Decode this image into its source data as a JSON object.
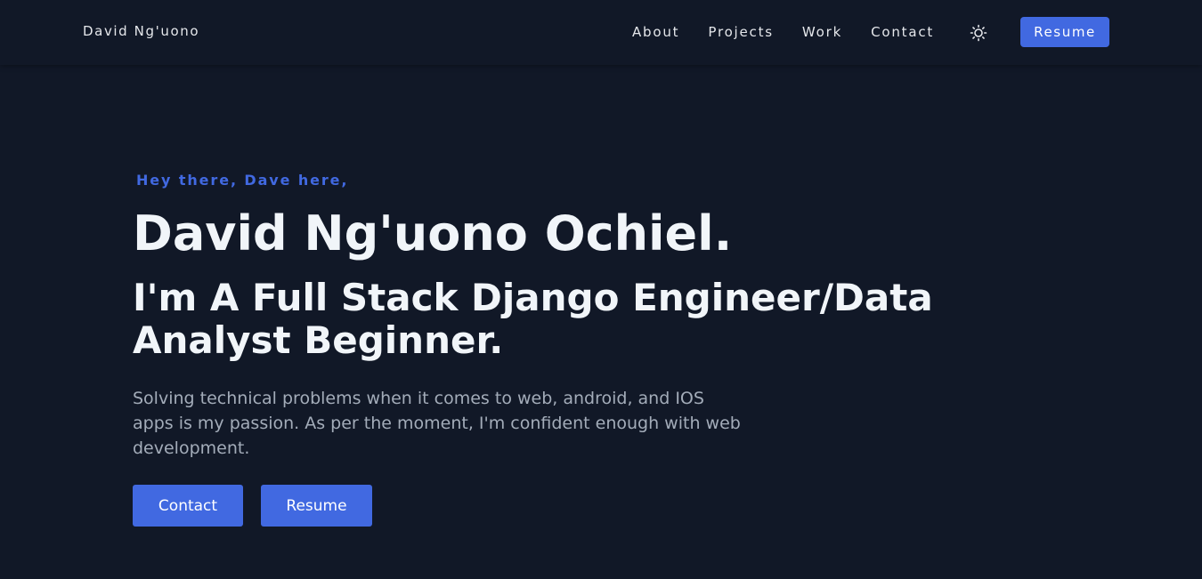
{
  "nav": {
    "brand": "David Ng'uono",
    "links": [
      "About",
      "Projects",
      "Work",
      "Contact"
    ],
    "theme_toggle_icon": "sun-icon",
    "resume_label": "Resume"
  },
  "hero": {
    "greeting": "Hey there, Dave here,",
    "name": "David Ng'uono Ochiel.",
    "role": "I'm A Full Stack Django Engineer/Data Analyst Beginner.",
    "description": "Solving technical problems when it comes to web, android, and IOS apps is my passion. As per the moment, I'm confident enough with web development.",
    "contact_label": "Contact",
    "resume_label": "Resume"
  },
  "colors": {
    "background": "#111827",
    "accent": "#4169e1",
    "heading": "#f1f5f9",
    "body_text": "#a3acb9"
  }
}
